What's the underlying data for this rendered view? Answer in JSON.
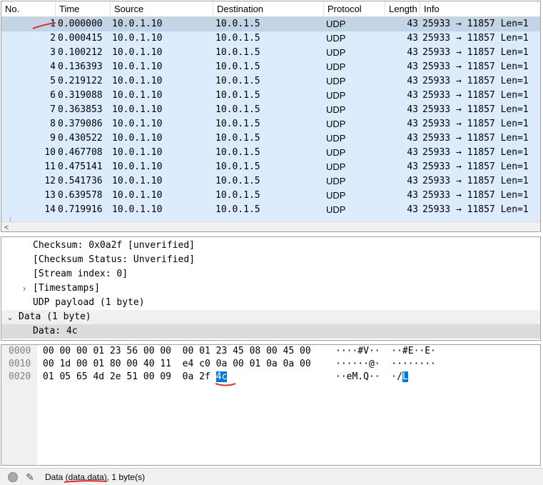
{
  "packet_list": {
    "columns": [
      "No.",
      "Time",
      "Source",
      "Destination",
      "Protocol",
      "Length",
      "Info"
    ],
    "rows": [
      {
        "no": "1",
        "time": "0.000000",
        "src": "10.0.1.10",
        "dst": "10.0.1.5",
        "proto": "UDP",
        "len": "43",
        "info": "25933 → 11857 Len=1"
      },
      {
        "no": "2",
        "time": "0.000415",
        "src": "10.0.1.10",
        "dst": "10.0.1.5",
        "proto": "UDP",
        "len": "43",
        "info": "25933 → 11857 Len=1"
      },
      {
        "no": "3",
        "time": "0.100212",
        "src": "10.0.1.10",
        "dst": "10.0.1.5",
        "proto": "UDP",
        "len": "43",
        "info": "25933 → 11857 Len=1"
      },
      {
        "no": "4",
        "time": "0.136393",
        "src": "10.0.1.10",
        "dst": "10.0.1.5",
        "proto": "UDP",
        "len": "43",
        "info": "25933 → 11857 Len=1"
      },
      {
        "no": "5",
        "time": "0.219122",
        "src": "10.0.1.10",
        "dst": "10.0.1.5",
        "proto": "UDP",
        "len": "43",
        "info": "25933 → 11857 Len=1"
      },
      {
        "no": "6",
        "time": "0.319088",
        "src": "10.0.1.10",
        "dst": "10.0.1.5",
        "proto": "UDP",
        "len": "43",
        "info": "25933 → 11857 Len=1"
      },
      {
        "no": "7",
        "time": "0.363853",
        "src": "10.0.1.10",
        "dst": "10.0.1.5",
        "proto": "UDP",
        "len": "43",
        "info": "25933 → 11857 Len=1"
      },
      {
        "no": "8",
        "time": "0.379086",
        "src": "10.0.1.10",
        "dst": "10.0.1.5",
        "proto": "UDP",
        "len": "43",
        "info": "25933 → 11857 Len=1"
      },
      {
        "no": "9",
        "time": "0.430522",
        "src": "10.0.1.10",
        "dst": "10.0.1.5",
        "proto": "UDP",
        "len": "43",
        "info": "25933 → 11857 Len=1"
      },
      {
        "no": "10",
        "time": "0.467708",
        "src": "10.0.1.10",
        "dst": "10.0.1.5",
        "proto": "UDP",
        "len": "43",
        "info": "25933 → 11857 Len=1"
      },
      {
        "no": "11",
        "time": "0.475141",
        "src": "10.0.1.10",
        "dst": "10.0.1.5",
        "proto": "UDP",
        "len": "43",
        "info": "25933 → 11857 Len=1"
      },
      {
        "no": "12",
        "time": "0.541736",
        "src": "10.0.1.10",
        "dst": "10.0.1.5",
        "proto": "UDP",
        "len": "43",
        "info": "25933 → 11857 Len=1"
      },
      {
        "no": "13",
        "time": "0.639578",
        "src": "10.0.1.10",
        "dst": "10.0.1.5",
        "proto": "UDP",
        "len": "43",
        "info": "25933 → 11857 Len=1"
      },
      {
        "no": "14",
        "time": "0.719916",
        "src": "10.0.1.10",
        "dst": "10.0.1.5",
        "proto": "UDP",
        "len": "43",
        "info": "25933 → 11857 Len=1"
      }
    ]
  },
  "details": {
    "checksum": "Checksum: 0x0a2f [unverified]",
    "checksum_status": "[Checksum Status: Unverified]",
    "stream_index": "[Stream index: 0]",
    "timestamps": "[Timestamps]",
    "udp_payload": "UDP payload (1 byte)",
    "data_header": "Data (1 byte)",
    "data_value": "Data: 4c"
  },
  "bytes": {
    "rows": [
      {
        "offset": "0000",
        "hex": "00 00 00 01 23 56 00 00  00 01 23 45 08 00 45 00",
        "ascii": "····#V··  ··#E··E·"
      },
      {
        "offset": "0010",
        "hex": "00 1d 00 01 80 00 40 11  e4 c0 0a 00 01 0a 0a 00",
        "ascii": "······@·  ········"
      },
      {
        "offset": "0020",
        "hex_prefix": "01 05 65 4d 2e 51 00 09  0a 2f ",
        "hex_highlight": "4c",
        "ascii_prefix": "··eM.Q··  ·/",
        "ascii_highlight": "L"
      }
    ]
  },
  "status": {
    "text": "Data (data.data), 1 byte(s)"
  },
  "colors": {
    "row_bg": "#dcecfc",
    "row_selected": "#c3d4e6",
    "byte_highlight": "#0078d7",
    "annotation_red": "#e02020"
  }
}
